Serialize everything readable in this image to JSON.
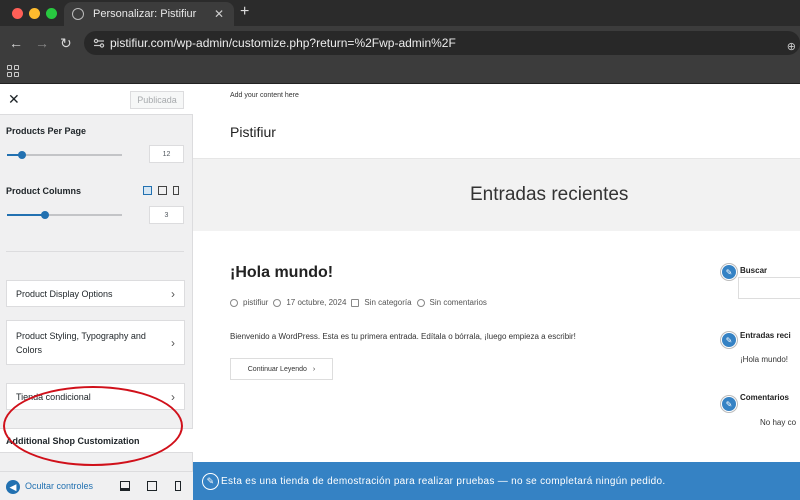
{
  "browser": {
    "tab_title": "Personalizar: Pistifiur",
    "tab_close": "✕",
    "new_tab": "+",
    "url": "pistifiur.com/wp-admin/customize.php?return=%2Fwp-admin%2F",
    "back": "←",
    "forward": "→",
    "reload": "↻",
    "zoom": "⊕"
  },
  "sidebar": {
    "close": "✕",
    "publish": "Publicada",
    "products_per_page": {
      "label": "Products Per Page",
      "value": "12",
      "level": 0.13
    },
    "product_columns": {
      "label": "Product Columns",
      "value": "3",
      "level": 0.33
    },
    "sections": [
      {
        "label": "Product Display Options",
        "chev": "›"
      },
      {
        "label": "Product Styling, Typography and Colors",
        "chev": "›"
      },
      {
        "label": "Tienda condicional",
        "chev": "›"
      }
    ],
    "additional": "Additional Shop Customization",
    "hide_controls": "Ocultar controles",
    "hide_icon": "◀",
    "annotation_color": "#d0101a"
  },
  "preview": {
    "top_text": "Add your content here",
    "site_title": "Pistifiur",
    "hero_title": "Entradas recientes",
    "post": {
      "title": "¡Hola mundo!",
      "author": "pistifiur",
      "date": "17 octubre, 2024",
      "category": "Sin categoría",
      "comments": "Sin comentarios",
      "excerpt": "Bienvenido a WordPress. Esta es tu primera entrada. Edítala o bórrala, ¡luego empieza a escribir!",
      "continue": "Continuar Leyendo",
      "continue_chev": "›"
    },
    "widgets": {
      "search": "Buscar",
      "recent": "Entradas reci",
      "recent_item": "¡Hola mundo!",
      "comments": "Comentarios",
      "comments_item": "No hay co"
    },
    "pencil": "✎"
  },
  "store_notice": "Esta es una tienda de demostración para realizar pruebas — no se completará ningún pedido.",
  "colors": {
    "accent": "#2271b1",
    "notice": "#3582c4"
  }
}
